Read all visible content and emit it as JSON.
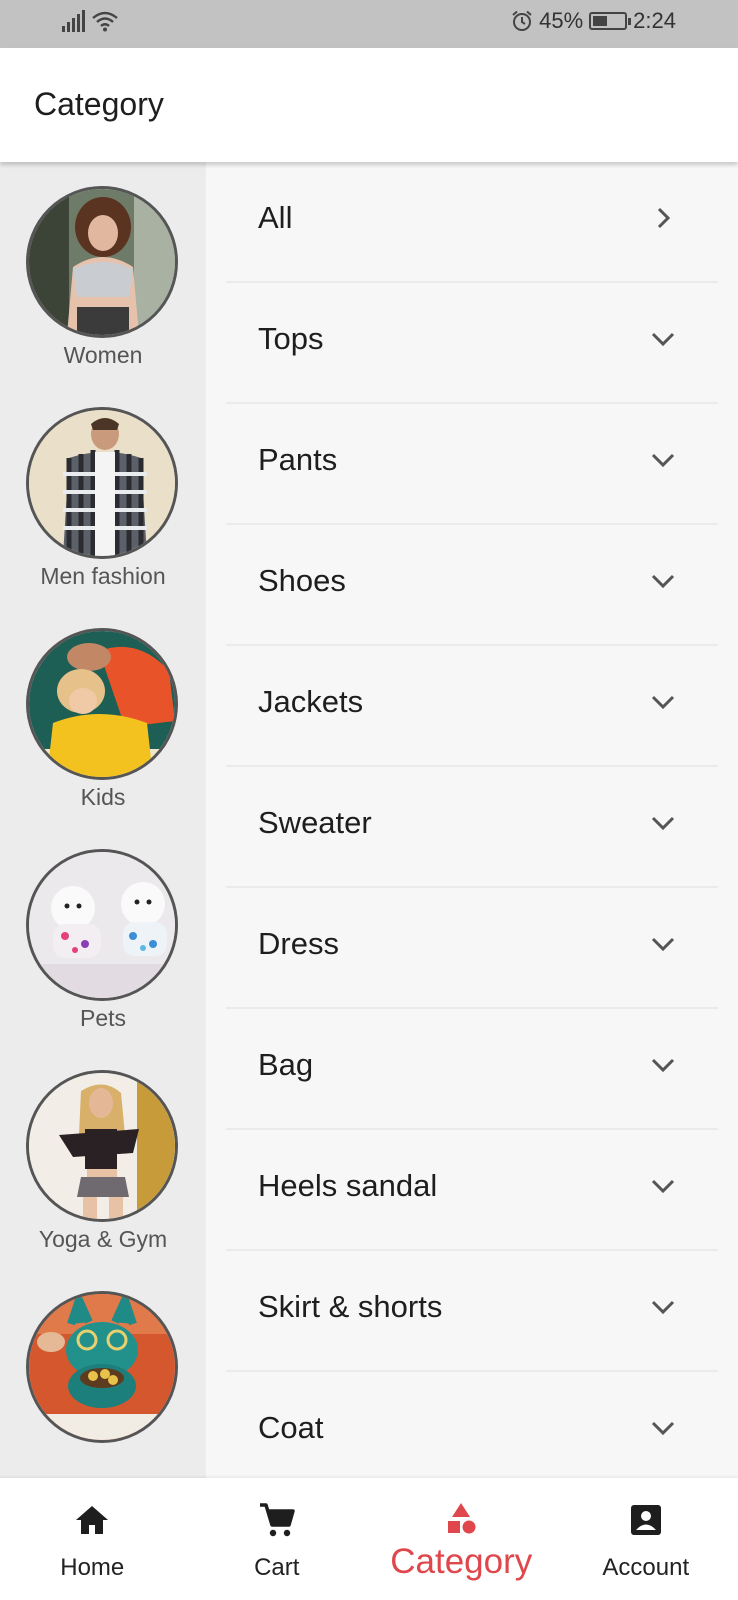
{
  "status_bar": {
    "battery_percent": "45%",
    "battery_level": 0.45,
    "time": "2:24",
    "icons": [
      "signal-icon",
      "wifi-icon",
      "alarm-icon",
      "battery-icon"
    ]
  },
  "app_bar": {
    "title": "Category"
  },
  "sidebar": {
    "items": [
      {
        "label": "Women",
        "image": "woman-photo"
      },
      {
        "label": "Men fashion",
        "image": "man-photo"
      },
      {
        "label": "Kids",
        "image": "kids-photo"
      },
      {
        "label": "Pets",
        "image": "pets-photo"
      },
      {
        "label": "Yoga & Gym",
        "image": "yoga-photo"
      },
      {
        "label": "",
        "image": "decor-photo"
      }
    ]
  },
  "categories": {
    "items": [
      {
        "label": "All",
        "icon": "chevron-right-icon"
      },
      {
        "label": "Tops",
        "icon": "chevron-down-icon"
      },
      {
        "label": "Pants",
        "icon": "chevron-down-icon"
      },
      {
        "label": "Shoes",
        "icon": "chevron-down-icon"
      },
      {
        "label": "Jackets",
        "icon": "chevron-down-icon"
      },
      {
        "label": "Sweater",
        "icon": "chevron-down-icon"
      },
      {
        "label": "Dress",
        "icon": "chevron-down-icon"
      },
      {
        "label": "Bag",
        "icon": "chevron-down-icon"
      },
      {
        "label": "Heels sandal",
        "icon": "chevron-down-icon"
      },
      {
        "label": "Skirt & shorts",
        "icon": "chevron-down-icon"
      },
      {
        "label": "Coat",
        "icon": "chevron-down-icon"
      }
    ]
  },
  "bottom_nav": {
    "items": [
      {
        "label": "Home",
        "icon": "home-icon"
      },
      {
        "label": "Cart",
        "icon": "cart-icon"
      },
      {
        "label": "Category",
        "icon": "category-icon",
        "active": true
      },
      {
        "label": "Account",
        "icon": "account-icon"
      }
    ]
  },
  "colors": {
    "accent": "#e0474c",
    "sidebar_bg": "#ececec",
    "list_bg": "#f7f7f7",
    "status_bar_bg": "#c2c2c2"
  }
}
